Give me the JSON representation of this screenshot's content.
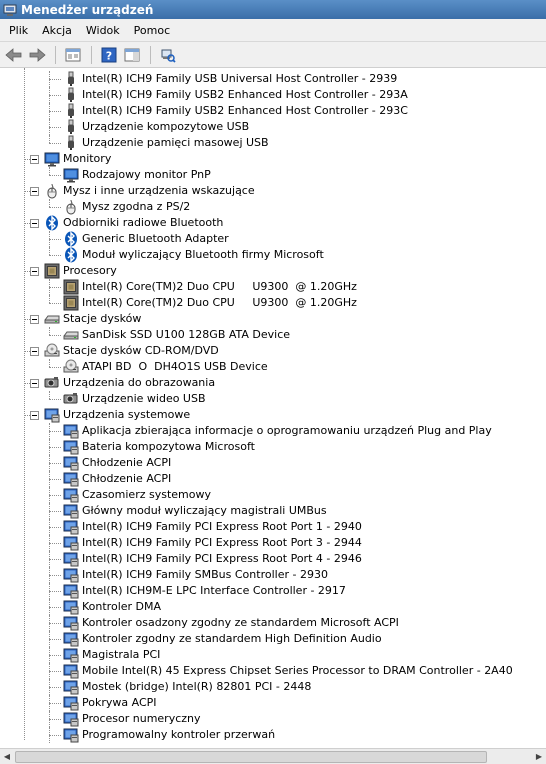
{
  "window": {
    "title": "Menedżer urządzeń"
  },
  "menu": [
    "Plik",
    "Akcja",
    "Widok",
    "Pomoc"
  ],
  "toolbar": [
    "back-icon",
    "forward-icon",
    "properties-icon",
    "help-icon",
    "action-pane-icon",
    "scan-hardware-icon"
  ],
  "tree": [
    {
      "level": 1,
      "icon": "usb",
      "label": "Intel(R) ICH9 Family USB Universal Host Controller - 2939"
    },
    {
      "level": 1,
      "icon": "usb",
      "label": "Intel(R) ICH9 Family USB2 Enhanced Host Controller - 293A"
    },
    {
      "level": 1,
      "icon": "usb",
      "label": "Intel(R) ICH9 Family USB2 Enhanced Host Controller - 293C"
    },
    {
      "level": 1,
      "icon": "usb",
      "label": "Urządzenie kompozytowe USB"
    },
    {
      "level": 1,
      "icon": "usb",
      "label": "Urządzenie pamięci masowej USB",
      "last": true
    },
    {
      "level": 0,
      "icon": "monitor",
      "label": "Monitory",
      "expanded": true
    },
    {
      "level": 1,
      "icon": "monitor",
      "label": "Rodzajowy monitor PnP",
      "last": true
    },
    {
      "level": 0,
      "icon": "mouse",
      "label": "Mysz i inne urządzenia wskazujące",
      "expanded": true
    },
    {
      "level": 1,
      "icon": "mouse",
      "label": "Mysz zgodna z PS/2",
      "last": true
    },
    {
      "level": 0,
      "icon": "bluetooth",
      "label": "Odbiorniki radiowe Bluetooth",
      "expanded": true
    },
    {
      "level": 1,
      "icon": "bluetooth",
      "label": "Generic Bluetooth Adapter"
    },
    {
      "level": 1,
      "icon": "bluetooth",
      "label": "Moduł wyliczający Bluetooth firmy Microsoft",
      "last": true
    },
    {
      "level": 0,
      "icon": "cpu",
      "label": "Procesory",
      "expanded": true
    },
    {
      "level": 1,
      "icon": "cpu",
      "label": "Intel(R) Core(TM)2 Duo CPU     U9300  @ 1.20GHz"
    },
    {
      "level": 1,
      "icon": "cpu",
      "label": "Intel(R) Core(TM)2 Duo CPU     U9300  @ 1.20GHz",
      "last": true
    },
    {
      "level": 0,
      "icon": "disk",
      "label": "Stacje dysków",
      "expanded": true
    },
    {
      "level": 1,
      "icon": "disk",
      "label": "SanDisk SSD U100 128GB ATA Device",
      "last": true
    },
    {
      "level": 0,
      "icon": "cdrom",
      "label": "Stacje dysków CD-ROM/DVD",
      "expanded": true
    },
    {
      "level": 1,
      "icon": "cdrom",
      "label": "ATAPI BD  O  DH4O1S USB Device",
      "last": true
    },
    {
      "level": 0,
      "icon": "camera",
      "label": "Urządzenia do obrazowania",
      "expanded": true
    },
    {
      "level": 1,
      "icon": "camera",
      "label": "Urządzenie wideo USB",
      "last": true
    },
    {
      "level": 0,
      "icon": "system",
      "label": "Urządzenia systemowe",
      "expanded": true
    },
    {
      "level": 1,
      "icon": "system",
      "label": "Aplikacja zbierająca informacje o oprogramowaniu urządzeń Plug and Play"
    },
    {
      "level": 1,
      "icon": "system",
      "label": "Bateria kompozytowa Microsoft"
    },
    {
      "level": 1,
      "icon": "system",
      "label": "Chłodzenie ACPI"
    },
    {
      "level": 1,
      "icon": "system",
      "label": "Chłodzenie ACPI"
    },
    {
      "level": 1,
      "icon": "system",
      "label": "Czasomierz systemowy"
    },
    {
      "level": 1,
      "icon": "system",
      "label": "Główny moduł wyliczający magistrali UMBus"
    },
    {
      "level": 1,
      "icon": "system",
      "label": "Intel(R) ICH9 Family PCI Express Root Port 1 - 2940"
    },
    {
      "level": 1,
      "icon": "system",
      "label": "Intel(R) ICH9 Family PCI Express Root Port 3 - 2944"
    },
    {
      "level": 1,
      "icon": "system",
      "label": "Intel(R) ICH9 Family PCI Express Root Port 4 - 2946"
    },
    {
      "level": 1,
      "icon": "system",
      "label": "Intel(R) ICH9 Family SMBus Controller - 2930"
    },
    {
      "level": 1,
      "icon": "system",
      "label": "Intel(R) ICH9M-E LPC Interface Controller - 2917"
    },
    {
      "level": 1,
      "icon": "system",
      "label": "Kontroler DMA"
    },
    {
      "level": 1,
      "icon": "system",
      "label": "Kontroler osadzony zgodny ze standardem Microsoft ACPI"
    },
    {
      "level": 1,
      "icon": "system",
      "label": "Kontroler zgodny ze standardem High Definition Audio"
    },
    {
      "level": 1,
      "icon": "system",
      "label": "Magistrala PCI"
    },
    {
      "level": 1,
      "icon": "system",
      "label": "Mobile Intel(R) 45 Express Chipset Series Processor to DRAM Controller - 2A40"
    },
    {
      "level": 1,
      "icon": "system",
      "label": "Mostek (bridge) Intel(R) 82801 PCI - 2448"
    },
    {
      "level": 1,
      "icon": "system",
      "label": "Pokrywa ACPI"
    },
    {
      "level": 1,
      "icon": "system",
      "label": "Procesor numeryczny"
    },
    {
      "level": 1,
      "icon": "system",
      "label": "Programowalny kontroler przerwań"
    }
  ],
  "colors": {
    "titlebar": "#3a6ea8",
    "menubar": "#f0f0f0",
    "bluetooth": "#0a56b8",
    "monitor": "#1f5fbf"
  }
}
